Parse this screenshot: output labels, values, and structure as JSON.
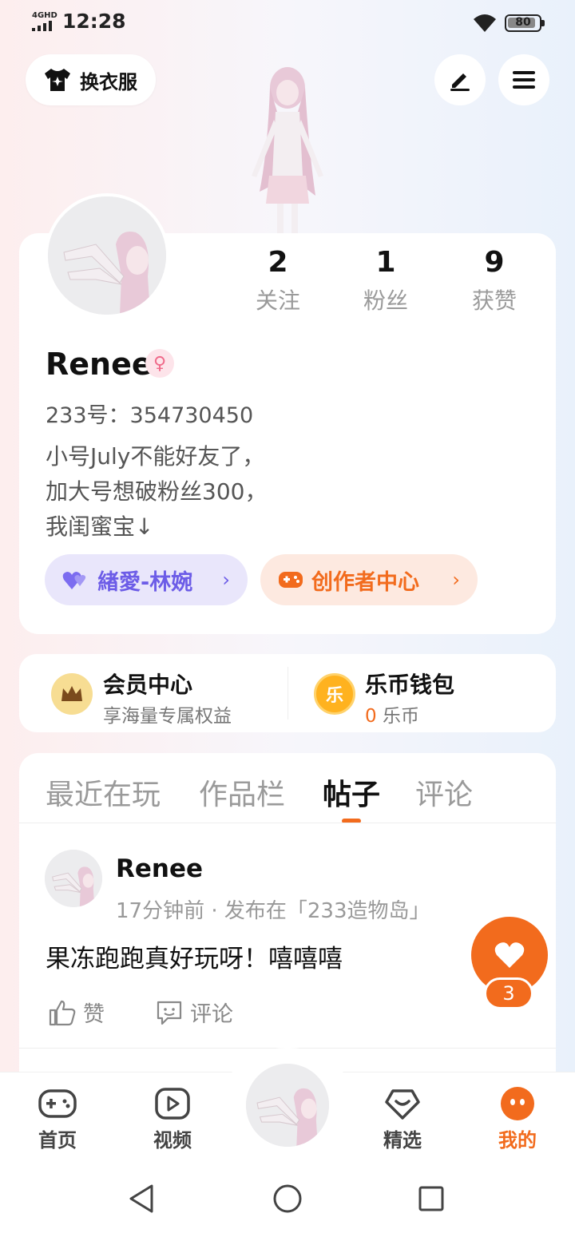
{
  "status_bar": {
    "network": "4GHD",
    "time": "12:28",
    "battery": "80"
  },
  "top": {
    "outfit_label": "换衣服"
  },
  "stats": [
    {
      "num": "2",
      "label": "关注"
    },
    {
      "num": "1",
      "label": "粉丝"
    },
    {
      "num": "9",
      "label": "获赞"
    }
  ],
  "profile": {
    "username": "Renee",
    "gender_symbol": "♀",
    "id_text": "233号：354730450",
    "bio": "小号July不能好友了，\n加大号想破粉丝300，\n我闺蜜宝↓"
  },
  "pills": {
    "love": "緖愛-林婉",
    "creator": "创作者中心"
  },
  "member": {
    "title": "会员中心",
    "subtitle": "享海量专属权益"
  },
  "wallet": {
    "title": "乐币钱包",
    "amount": "0",
    "unit": "乐币",
    "icon_char": "乐"
  },
  "tabs": [
    "最近在玩",
    "作品栏",
    "帖子",
    "评论"
  ],
  "active_tab": "帖子",
  "post": {
    "user": "Renee",
    "meta": "17分钟前 · 发布在「233造物岛」",
    "text": "果冻跑跑真好玩呀！嘻嘻嘻",
    "like_label": "赞",
    "comment_label": "评论"
  },
  "fab": {
    "count": "3"
  },
  "bottom_nav": [
    {
      "label": "首页",
      "icon": "gamepad-icon"
    },
    {
      "label": "视频",
      "icon": "play-icon"
    },
    {
      "label": "精选",
      "icon": "heart-badge-icon"
    },
    {
      "label": "我的",
      "icon": "face-icon"
    }
  ],
  "colors": {
    "accent": "#f26b1d",
    "purple": "#6c5ce7",
    "pink": "#f06a8a"
  }
}
